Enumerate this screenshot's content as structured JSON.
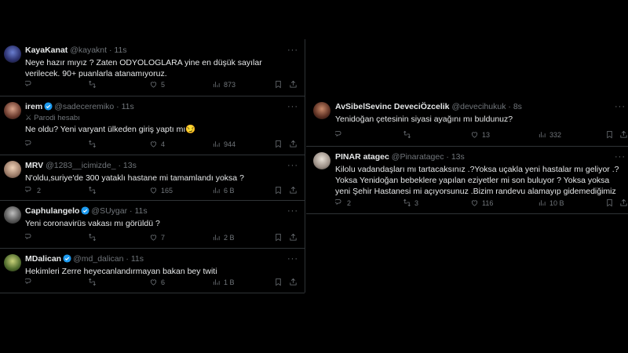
{
  "left_tweets": [
    {
      "name": "KayaKanat",
      "handle": "@kayaknt",
      "time": "11s",
      "verified": false,
      "parody": "",
      "text": "Neye hazır mıyız ? Zaten ODYOLOGLARA yine en düşük sayılar verilecek. 90+ puanlarla atanamıyoruz.",
      "replies": "",
      "retweets": "",
      "likes": "5",
      "views": "873"
    },
    {
      "name": "irem",
      "handle": "@sadeceremiko",
      "time": "11s",
      "verified": true,
      "parody": "Parodi hesabı",
      "text": "Ne oldu? Yeni varyant ülkeden giriş yaptı mı😏",
      "replies": "",
      "retweets": "",
      "likes": "4",
      "views": "944"
    },
    {
      "name": "MRV",
      "handle": "@1283__icimizde_",
      "time": "13s",
      "verified": false,
      "parody": "",
      "text": "N'oldu,suriye'de 300 yataklı hastane mi tamamlandı yoksa ?",
      "replies": "2",
      "retweets": "",
      "likes": "165",
      "views": "6 B"
    },
    {
      "name": "Caphulangelo",
      "handle": "@SUygar",
      "time": "11s",
      "verified": true,
      "parody": "",
      "text": "Yeni coronavirüs vakası mı görüldü ?",
      "replies": "",
      "retweets": "",
      "likes": "7",
      "views": "2 B"
    },
    {
      "name": "MDalican",
      "handle": "@md_dalican",
      "time": "11s",
      "verified": true,
      "parody": "",
      "text": "Hekimleri Zerre heyecanlandırmayan bakan bey twiti",
      "replies": "",
      "retweets": "",
      "likes": "6",
      "views": "1 B"
    }
  ],
  "right_tweets": [
    {
      "name": "AvSibelSevinc DeveciÖzcelik",
      "handle": "@devecihukuk",
      "time": "8s",
      "verified": false,
      "text": "Yenidoğan çetesinin siyasi ayağını mı buldunuz?",
      "replies": "",
      "retweets": "",
      "likes": "13",
      "views": "332"
    },
    {
      "name": "PINAR atagec",
      "handle": "@Pinaratagec",
      "time": "13s",
      "verified": false,
      "text": "Kilolu vadandaşları mı tartacaksınız .?Yoksa uçakla yeni hastalar mı geliyor .?Yoksa Yenidoğan bebeklere yapılan eziyetler mi son buluyor ? Yoksa yoksa yeni Şehir Hastanesi mi açıyorsunuz .Bizim randevu alamayıp gidemediğimiz",
      "replies": "2",
      "retweets": "3",
      "likes": "116",
      "views": "10 B"
    }
  ],
  "separator": "·",
  "more_label": "···",
  "colors": {
    "background": "#000000",
    "text": "#e7e9ea",
    "muted": "#71767b",
    "verified": "#1d9bf0",
    "divider": "#2f3336"
  },
  "icons": [
    "reply-icon",
    "retweet-icon",
    "like-icon",
    "views-icon",
    "bookmark-icon",
    "share-icon",
    "more-icon",
    "verified-badge-icon",
    "parody-mask-icon"
  ]
}
